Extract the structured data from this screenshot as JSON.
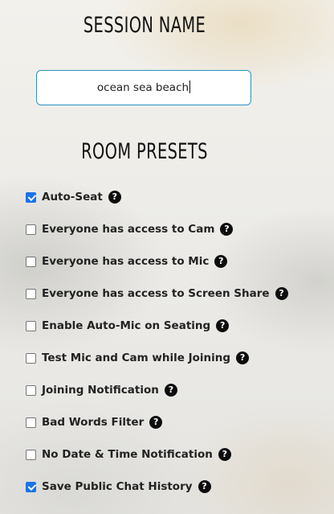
{
  "session": {
    "title": "SESSION NAME",
    "value": "ocean sea beach"
  },
  "presets": {
    "title": "ROOM PRESETS",
    "help_glyph": "?",
    "items": [
      {
        "label": "Auto-Seat",
        "checked": true
      },
      {
        "label": "Everyone has access to Cam",
        "checked": false
      },
      {
        "label": "Everyone has access to Mic",
        "checked": false
      },
      {
        "label": "Everyone has access to Screen Share",
        "checked": false
      },
      {
        "label": "Enable Auto-Mic on Seating",
        "checked": false
      },
      {
        "label": "Test Mic and Cam while Joining",
        "checked": false
      },
      {
        "label": "Joining Notification",
        "checked": false
      },
      {
        "label": "Bad Words Filter",
        "checked": false
      },
      {
        "label": "No Date & Time Notification",
        "checked": false
      },
      {
        "label": "Save Public Chat History",
        "checked": true
      }
    ]
  }
}
